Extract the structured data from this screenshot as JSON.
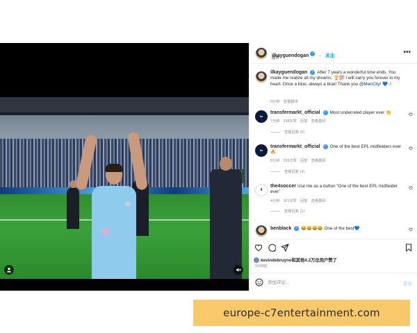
{
  "post": {
    "author": "ilkayguendogan",
    "follow_label": "关注",
    "audio_label": "原声",
    "caption_author": "ilkayguendogan",
    "caption_text": "After 7 years a wonderful time ends. You made me realize all my dreams. 🏆💯 I will carry you forever in my heart. Once a blue, always a blue! Thank you",
    "caption_mention": "@ManCity!",
    "caption_tail": "💙👌🏻",
    "caption_time": "9分钟",
    "caption_translate": "查看翻译"
  },
  "comments": [
    {
      "user": "transfermarkt_official",
      "verified": true,
      "text": "Most underrated player ever 👏",
      "time": "7分钟",
      "likes": "398次赞",
      "reply": "回复",
      "translate": "查看翻译",
      "view_replies": "查看回复 (6)"
    },
    {
      "user": "transfermarkt_official",
      "verified": true,
      "text": "One of the best EPL midfielders ever 🔥",
      "time": "8分钟",
      "likes": "355次赞",
      "reply": "回复",
      "translate": "查看翻译",
      "view_replies": "查看回复 (4)"
    },
    {
      "user": "the4soccer",
      "verified": false,
      "text": "Use me as a button “One of the best EPL midfielder ever”",
      "time": "4分钟",
      "likes": "161次赞",
      "reply": "回复",
      "translate": "查看翻译",
      "view_replies": "查看回复 (1)"
    },
    {
      "user": "benblack",
      "verified": true,
      "text": "😂😂😂😂 One of the best💙",
      "time": "",
      "likes": "",
      "reply": "",
      "translate": "",
      "view_replies": ""
    }
  ],
  "likes_summary": {
    "user": "kevindebruyne",
    "text": "和其他4.2万位用户赞了"
  },
  "post_time": "9分钟前",
  "comment_box": {
    "placeholder": "添加评论...",
    "post_label": "发布"
  },
  "watermark": "europe-c7entertainment.com",
  "icons": {
    "more": "more-icon",
    "heart": "heart-icon",
    "comment": "comment-icon",
    "share": "share-icon",
    "save": "bookmark-icon",
    "emoji": "emoji-icon",
    "verified": "verified-badge-icon",
    "mute": "mute-icon",
    "tag": "user-tag-icon"
  },
  "colors": {
    "accent": "#0095f6",
    "verified": "#3897f0",
    "watermark_bg": "#f7c96a"
  }
}
